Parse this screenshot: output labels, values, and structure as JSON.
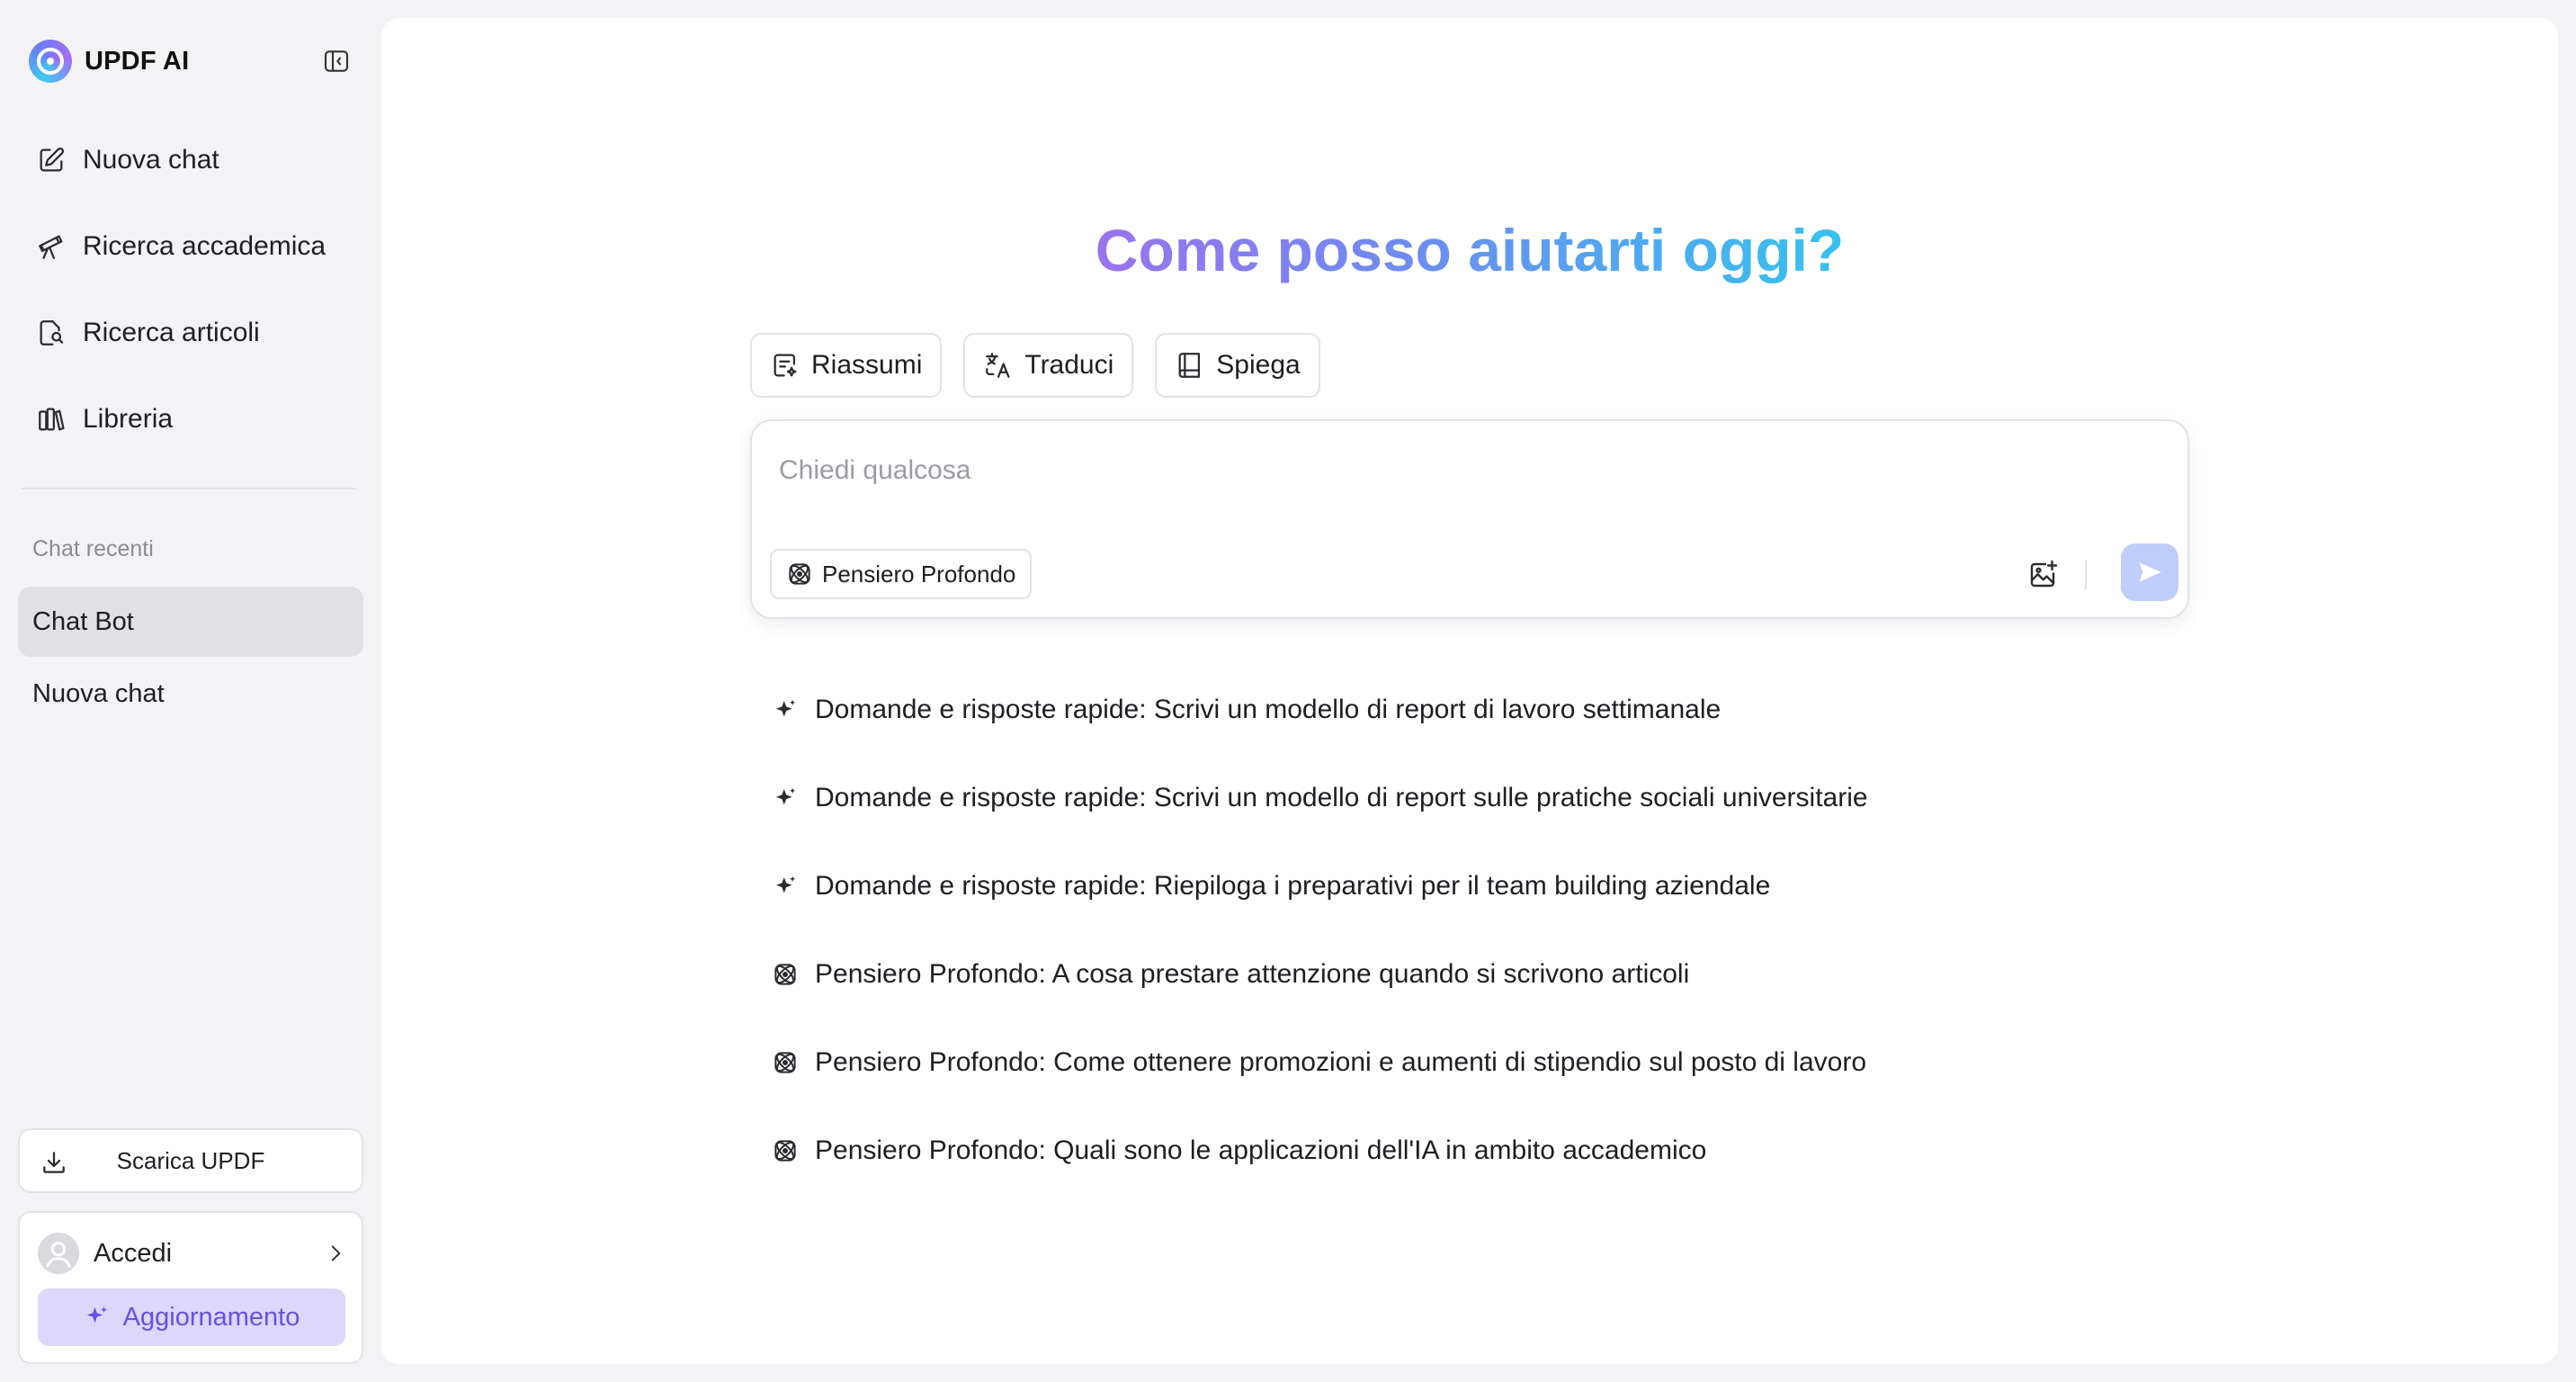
{
  "brand": {
    "name": "UPDF AI"
  },
  "sidebar": {
    "nav": [
      {
        "label": "Nuova chat",
        "icon": "edit-icon"
      },
      {
        "label": "Ricerca accademica",
        "icon": "telescope-icon"
      },
      {
        "label": "Ricerca articoli",
        "icon": "document-search-icon"
      },
      {
        "label": "Libreria",
        "icon": "library-icon"
      }
    ],
    "recent_label": "Chat recenti",
    "recent": [
      {
        "label": "Chat Bot",
        "active": true
      },
      {
        "label": "Nuova chat",
        "active": false
      }
    ],
    "download_label": "Scarica UPDF",
    "account": {
      "login_label": "Accedi",
      "upgrade_label": "Aggiornamento"
    }
  },
  "main": {
    "headline": "Come posso aiutarti oggi?",
    "quick_actions": [
      {
        "label": "Riassumi",
        "icon": "summary-icon"
      },
      {
        "label": "Traduci",
        "icon": "translate-icon"
      },
      {
        "label": "Spiega",
        "icon": "book-icon"
      }
    ],
    "composer": {
      "placeholder": "Chiedi qualcosa",
      "value": "",
      "deep_think_label": "Pensiero Profondo"
    },
    "suggestions": [
      {
        "text": "Domande e risposte rapide: Scrivi un modello di report di lavoro settimanale",
        "icon": "sparkle-icon"
      },
      {
        "text": "Domande e risposte rapide: Scrivi un modello di report sulle pratiche sociali universitarie",
        "icon": "sparkle-icon"
      },
      {
        "text": "Domande e risposte rapide: Riepiloga i preparativi per il team building aziendale",
        "icon": "sparkle-icon"
      },
      {
        "text": "Pensiero Profondo: A cosa prestare attenzione quando si scrivono articoli",
        "icon": "atom-icon"
      },
      {
        "text": "Pensiero Profondo: Come ottenere promozioni e aumenti di stipendio sul posto di lavoro",
        "icon": "atom-icon"
      },
      {
        "text": "Pensiero Profondo: Quali sono le applicazioni dell'IA in ambito accademico",
        "icon": "atom-icon"
      }
    ]
  },
  "colors": {
    "accent": "#6a4fe6",
    "upgrade_bg": "#ddd8fb",
    "send_bg": "#bfcdfa",
    "headline_gradient": [
      "#9a73ee",
      "#6f8bf1",
      "#36c2ee"
    ],
    "sidebar_bg": "#f3f3f5",
    "active_item_bg": "#e1e1e5"
  }
}
